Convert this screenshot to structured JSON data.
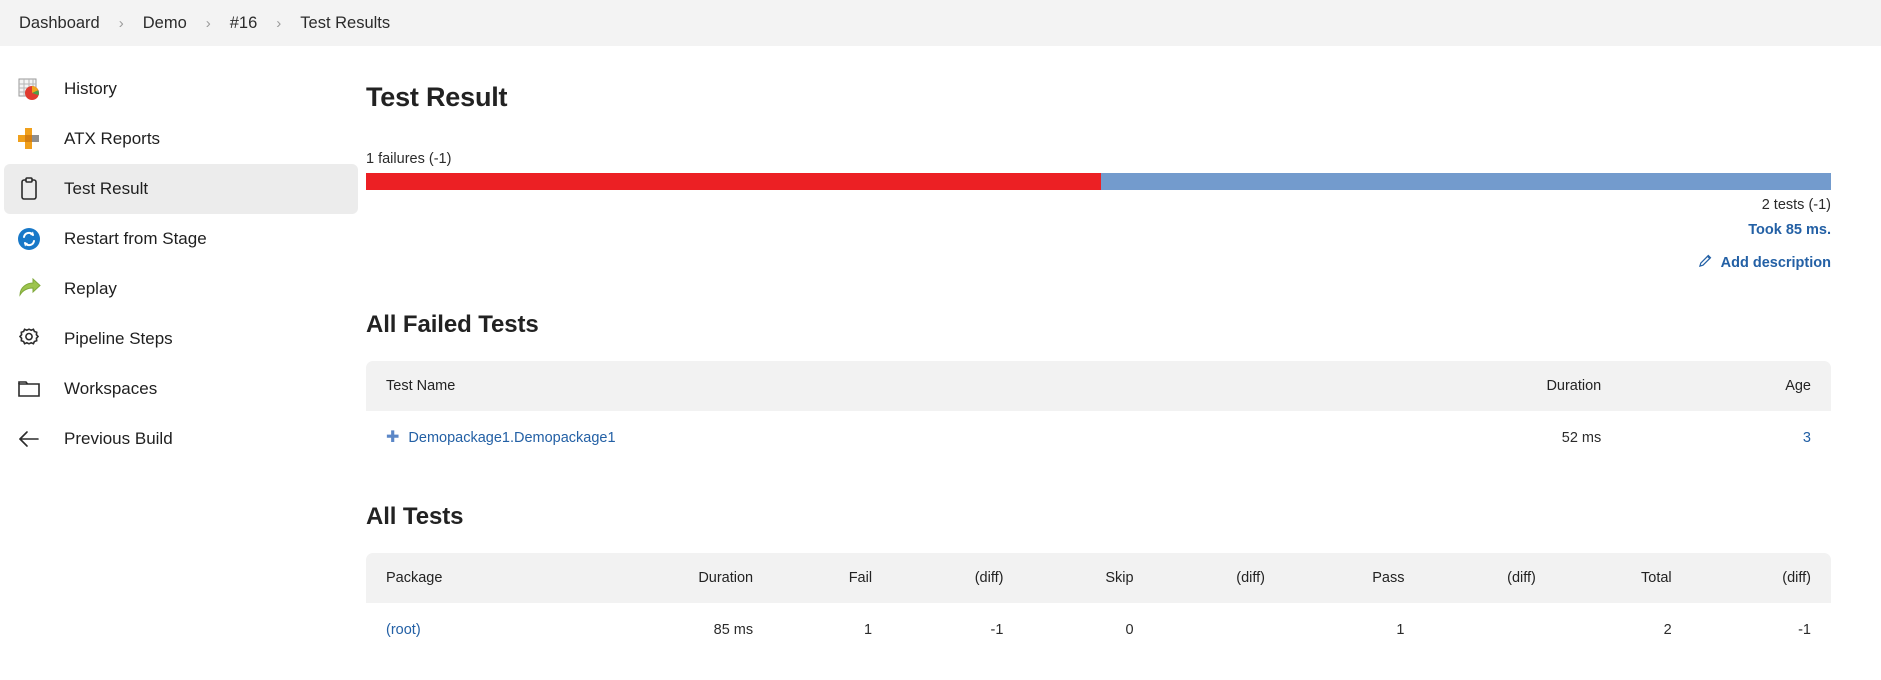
{
  "breadcrumb": {
    "separator": "›",
    "items": [
      {
        "label": "Dashboard"
      },
      {
        "label": "Demo"
      },
      {
        "label": "#16"
      },
      {
        "label": "Test Results"
      }
    ]
  },
  "sidebar": {
    "items": [
      {
        "label": "History",
        "icon": "history-chart-icon",
        "selected": false
      },
      {
        "label": "ATX Reports",
        "icon": "atx-reports-icon",
        "selected": false
      },
      {
        "label": "Test Result",
        "icon": "clipboard-icon",
        "selected": true
      },
      {
        "label": "Restart from Stage",
        "icon": "restart-circle-icon",
        "selected": false
      },
      {
        "label": "Replay",
        "icon": "replay-arrow-icon",
        "selected": false
      },
      {
        "label": "Pipeline Steps",
        "icon": "gear-icon",
        "selected": false
      },
      {
        "label": "Workspaces",
        "icon": "folder-icon",
        "selected": false
      },
      {
        "label": "Previous Build",
        "icon": "arrow-left-icon",
        "selected": false
      }
    ]
  },
  "main": {
    "page_title": "Test Result",
    "summary": {
      "failures_text": "1 failures (-1)",
      "tests_text": "2 tests (-1)",
      "took_text": "Took 85 ms.",
      "add_description_label": "Add description",
      "bar": {
        "fail_percent": 50.2,
        "pass_percent": 49.8,
        "fail_color": "#ec2024",
        "pass_color": "#739bcd"
      }
    },
    "failed_tests": {
      "title": "All Failed Tests",
      "columns": [
        {
          "label": "Test Name",
          "align": "left"
        },
        {
          "label": "Duration",
          "align": "right"
        },
        {
          "label": "Age",
          "align": "right"
        }
      ],
      "rows": [
        {
          "test_name": "Demopackage1.Demopackage1",
          "duration": "52 ms",
          "age": "3"
        }
      ]
    },
    "all_tests": {
      "title": "All Tests",
      "columns": [
        {
          "label": "Package",
          "align": "left"
        },
        {
          "label": "Duration",
          "align": "right"
        },
        {
          "label": "Fail",
          "align": "right"
        },
        {
          "label": "(diff)",
          "align": "right"
        },
        {
          "label": "Skip",
          "align": "right"
        },
        {
          "label": "(diff)",
          "align": "right"
        },
        {
          "label": "Pass",
          "align": "right"
        },
        {
          "label": "(diff)",
          "align": "right"
        },
        {
          "label": "Total",
          "align": "right"
        },
        {
          "label": "(diff)",
          "align": "right"
        }
      ],
      "rows": [
        {
          "package": "(root)",
          "duration": "85 ms",
          "fail": "1",
          "fail_diff": "-1",
          "skip": "0",
          "skip_diff": "",
          "pass": "1",
          "pass_diff": "",
          "total": "2",
          "total_diff": "-1"
        }
      ]
    }
  },
  "colors": {
    "link": "#2360a5",
    "header_bg": "#f2f2f2",
    "breadcrumb_bg": "#f3f3f3",
    "selected_bg": "#ececec"
  }
}
